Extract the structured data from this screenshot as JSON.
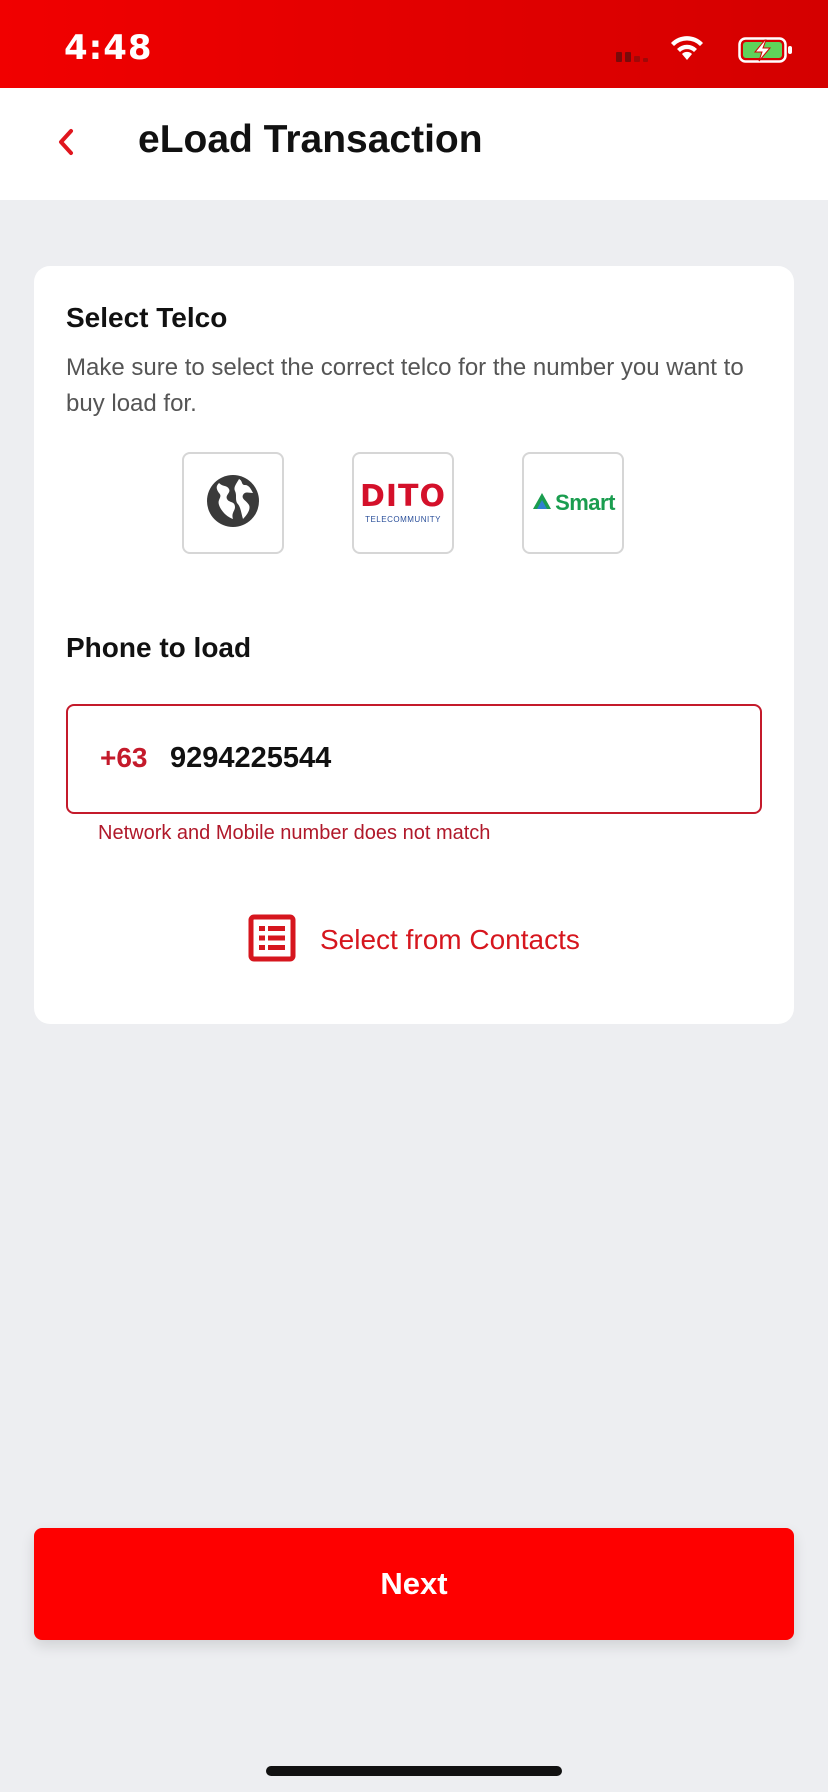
{
  "status_bar": {
    "time": "4:48",
    "icons": [
      "signal-icon",
      "wifi-icon",
      "battery-charging-icon"
    ]
  },
  "header": {
    "back_icon": "chevron-left-icon",
    "title": "eLoad Transaction"
  },
  "select_telco": {
    "title": "Select Telco",
    "description": "Make sure to select the correct telco for the number you want to buy load for.",
    "options": [
      {
        "name": "globe",
        "icon": "globe-icon"
      },
      {
        "name": "dito",
        "logo_text": "DITO",
        "logo_subtext": "TELECOMMUNITY"
      },
      {
        "name": "smart",
        "logo_text": "Smart"
      }
    ]
  },
  "phone": {
    "title": "Phone to load",
    "country_code": "+63",
    "value": "9294225544",
    "error": "Network and Mobile number does not match"
  },
  "contacts": {
    "icon": "contact-list-icon",
    "label": "Select from Contacts"
  },
  "next_button": {
    "label": "Next"
  },
  "colors": {
    "brand_red": "#fe0000",
    "error_red": "#c41a2b",
    "background": "#edeef1"
  }
}
